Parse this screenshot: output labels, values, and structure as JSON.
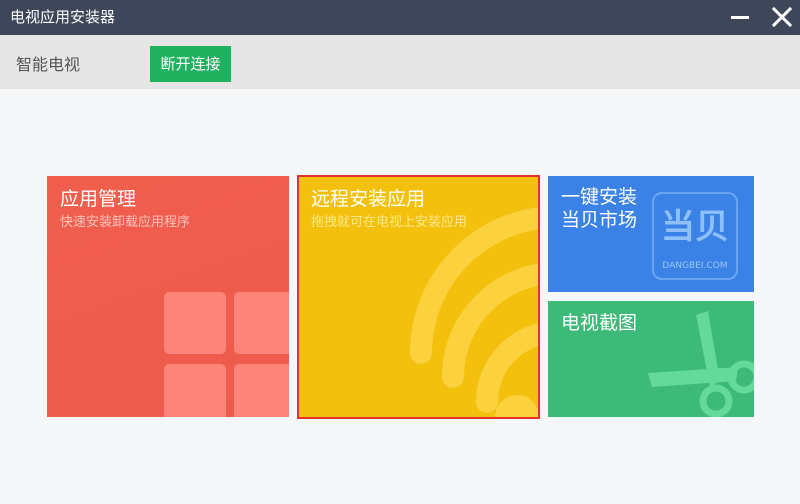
{
  "window": {
    "title": "电视应用安装器"
  },
  "connection": {
    "device_name": "智能电视",
    "disconnect_label": "断开连接"
  },
  "tiles": {
    "app_manage": {
      "title": "应用管理",
      "subtitle": "快速安装卸载应用程序"
    },
    "remote_install": {
      "title": "远程安装应用",
      "subtitle": "拖拽就可在电视上安装应用"
    },
    "market": {
      "title_line1": "一键安装",
      "title_line2": "当贝市场",
      "logo_text": "当贝",
      "logo_sub": "DANGBEI.COM"
    },
    "screenshot": {
      "title": "电视截图"
    }
  },
  "icons": {
    "minimize": "minimize-icon",
    "close": "close-icon",
    "app_grid": "app-grid-icon",
    "wifi": "wifi-icon",
    "scissors": "scissors-icon"
  },
  "colors": {
    "titlebar": "#3e4759",
    "connbar": "#e6e6e6",
    "disconnect": "#21b25f",
    "app_tile": "#ef5d4e",
    "remote_tile": "#f3c00d",
    "remote_border": "#e3342a",
    "market_tile": "#3a82e6",
    "screenshot_tile": "#3dba78"
  }
}
